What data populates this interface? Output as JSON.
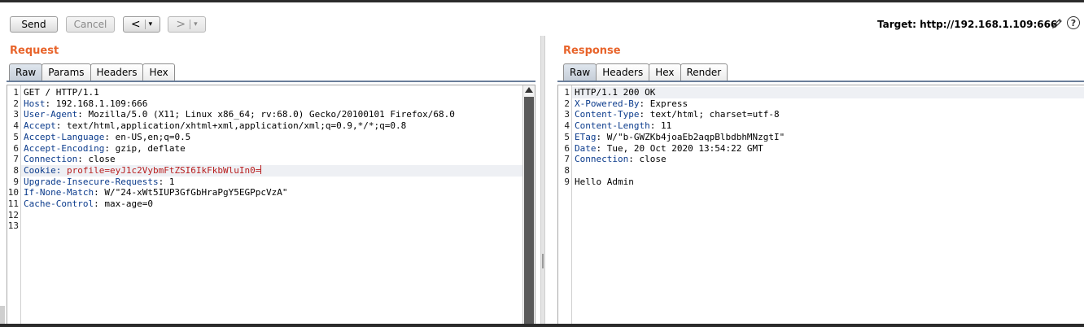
{
  "toolbar": {
    "send_label": "Send",
    "cancel_label": "Cancel",
    "back_label": "<",
    "forward_label": ">",
    "caret": "▾",
    "target_label": "Target: http://192.168.1.109:666",
    "help_label": "?",
    "icons": [
      "pencil-icon",
      "help-icon",
      "chevron-left-icon",
      "chevron-right-icon"
    ]
  },
  "request": {
    "title": "Request",
    "tabs": [
      "Raw",
      "Params",
      "Headers",
      "Hex"
    ],
    "active_tab": "Raw",
    "line_numbers": [
      "1",
      "2",
      "3",
      "4",
      "5",
      "6",
      "7",
      "8",
      "9",
      "10",
      "11",
      "12",
      "13"
    ],
    "lines": [
      {
        "name": "",
        "sep": "",
        "value": "GET / HTTP/1.1"
      },
      {
        "name": "Host",
        "sep": ": ",
        "value": "192.168.1.109:666"
      },
      {
        "name": "User-Agent",
        "sep": ": ",
        "value": "Mozilla/5.0 (X11; Linux x86_64; rv:68.0) Gecko/20100101 Firefox/68.0"
      },
      {
        "name": "Accept",
        "sep": ": ",
        "value": "text/html,application/xhtml+xml,application/xml;q=0.9,*/*;q=0.8"
      },
      {
        "name": "Accept-Language",
        "sep": ": ",
        "value": "en-US,en;q=0.5"
      },
      {
        "name": "Accept-Encoding",
        "sep": ": ",
        "value": "gzip, deflate"
      },
      {
        "name": "Connection",
        "sep": ": ",
        "value": "close"
      },
      {
        "name": "Cookie: ",
        "sep": "",
        "value": ""
      },
      {
        "name": "Upgrade-Insecure-Requests",
        "sep": ": ",
        "value": "1"
      },
      {
        "name": "If-None-Match",
        "sep": ": ",
        "value": "W/\"24-xWt5IUP3GfGbHraPgY5EGPpcVzA\""
      },
      {
        "name": "Cache-Control",
        "sep": ": ",
        "value": "max-age=0"
      }
    ],
    "cookie": {
      "name": "profile",
      "eq": "=",
      "value": "eyJ1c2VybmFtZSI6IkFkbWluIn0="
    }
  },
  "response": {
    "title": "Response",
    "tabs": [
      "Raw",
      "Headers",
      "Hex",
      "Render"
    ],
    "active_tab": "Raw",
    "line_numbers": [
      "1",
      "2",
      "3",
      "4",
      "5",
      "6",
      "7",
      "8",
      "9"
    ],
    "lines": [
      {
        "name": "",
        "sep": "",
        "value": "HTTP/1.1 200 OK"
      },
      {
        "name": "X-Powered-By",
        "sep": ": ",
        "value": "Express"
      },
      {
        "name": "Content-Type",
        "sep": ": ",
        "value": "text/html; charset=utf-8"
      },
      {
        "name": "Content-Length",
        "sep": ": ",
        "value": "11"
      },
      {
        "name": "ETag",
        "sep": ": ",
        "value": "W/\"b-GWZKb4joaEb2aqpBlbdbhMNzgtI\""
      },
      {
        "name": "Date",
        "sep": ": ",
        "value": "Tue, 20 Oct 2020 13:54:22 GMT"
      },
      {
        "name": "Connection",
        "sep": ": ",
        "value": "close"
      },
      {
        "name": "",
        "sep": "",
        "value": ""
      },
      {
        "name": "",
        "sep": "",
        "value": "Hello Admin"
      }
    ]
  },
  "colors": {
    "accent": "#e8642b",
    "header_name": "#0b3b8c",
    "cookie": "#b81d1d"
  }
}
